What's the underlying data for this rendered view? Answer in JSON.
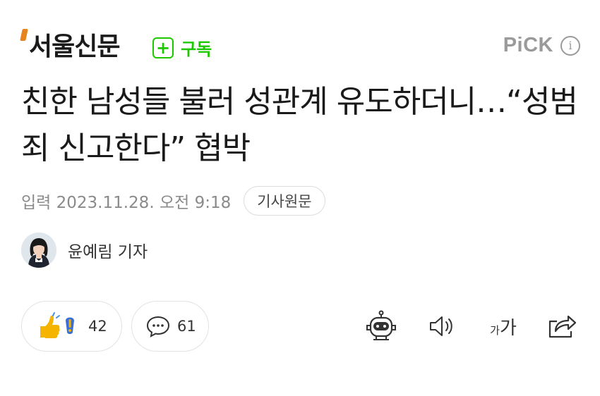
{
  "header": {
    "logo_text": "서울신문",
    "subscribe_label": "구독",
    "subscribe_symbol": "+",
    "pick_label": "PiCK",
    "info_symbol": "i",
    "accent_color": "#1ec800",
    "logo_accent_color": "#e8841f"
  },
  "article": {
    "title": "친한 남성들 불러 성관계 유도하더니…“성범죄 신고한다” 협박",
    "date": "입력 2023.11.28. 오전 9:18",
    "original_button": "기사원문",
    "reporter_name": "윤예림 기자"
  },
  "actions": {
    "reaction_count": "42",
    "comment_count": "61",
    "fontsize_small": "가",
    "fontsize_large": "가",
    "icons": [
      "reaction-icon",
      "comment-icon",
      "summary-bot-icon",
      "audio-icon",
      "font-size-icon",
      "share-icon"
    ]
  }
}
